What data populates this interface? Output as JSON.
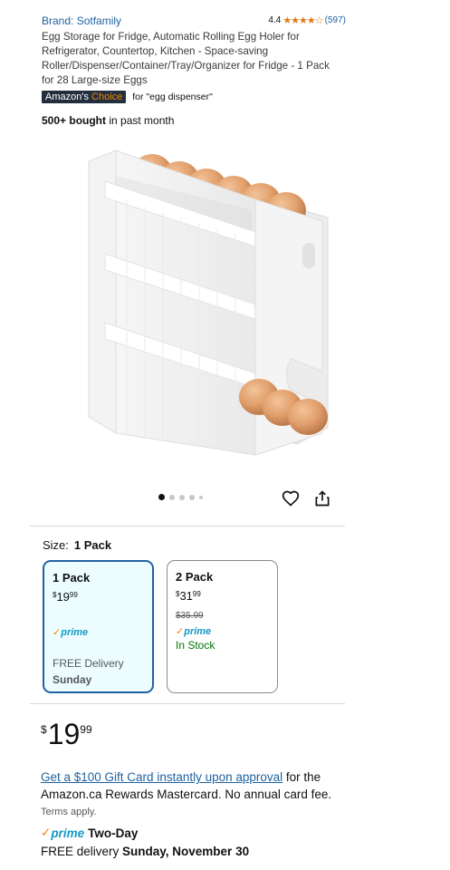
{
  "header": {
    "brand": "Brand: Sotfamily",
    "rating_value": "4.4",
    "stars": "★★★★☆",
    "rating_count": "(597)"
  },
  "title": "Egg Storage for Fridge, Automatic Rolling Egg Holer for Refrigerator, Countertop, Kitchen - Space-saving Roller/Dispenser/Container/Tray/Organizer for Fridge - 1 Pack for 28 Large-size Eggs",
  "badge": {
    "text_a": "Amazon's",
    "text_b": " Choice",
    "for_text": "for \"egg dispenser\""
  },
  "bought": {
    "bold": "500+ bought",
    "rest": " in past month"
  },
  "carousel": {
    "total": 5,
    "active_index": 0
  },
  "icons": {
    "heart": "heart-icon",
    "share": "share-icon"
  },
  "size": {
    "label": "Size:",
    "selected": "1 Pack",
    "options": [
      {
        "name": "1 Pack",
        "price_symbol": "$",
        "price_whole": "19",
        "price_fraction": "99",
        "prime": "prime",
        "delivery_line1": "FREE Delivery",
        "delivery_line2": "Sunday"
      },
      {
        "name": "2 Pack",
        "price_symbol": "$",
        "price_whole": "31",
        "price_fraction": "99",
        "list_price": "$35.99",
        "prime": "prime",
        "stock": "In Stock"
      }
    ]
  },
  "price": {
    "symbol": "$",
    "whole": "19",
    "fraction": "99"
  },
  "promo": {
    "link": "Get a $100 Gift Card instantly upon approval",
    "text": " for the Amazon.ca Rewards Mastercard. No annual card fee. ",
    "terms": "Terms apply."
  },
  "shipping": {
    "prime": "prime",
    "two_day": "Two-Day",
    "delivery_prefix": "FREE delivery ",
    "delivery_date": "Sunday, November 30"
  },
  "colors": {
    "link": "#2162a1",
    "prime_blue": "#1399c6",
    "check_orange": "#f08804",
    "selected_border": "#2162a1",
    "selected_bg": "#edfdff",
    "stock_green": "#007600",
    "star_orange": "#e47911"
  }
}
